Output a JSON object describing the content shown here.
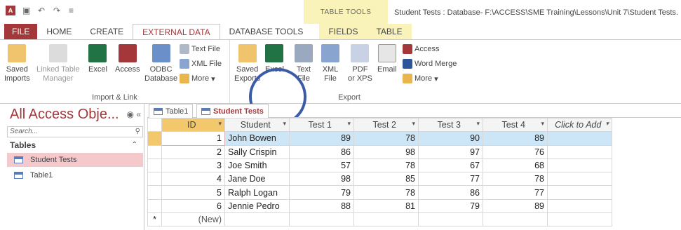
{
  "title_bar": {
    "app_badge": "A",
    "table_tools_label": "TABLE TOOLS",
    "window_title": "Student Tests : Database- F:\\ACCESS\\SME Training\\Lessons\\Unit 7\\Student Tests."
  },
  "ribbon_tabs": {
    "file": "FILE",
    "home": "HOME",
    "create": "CREATE",
    "external_data": "EXTERNAL DATA",
    "database_tools": "DATABASE TOOLS",
    "fields": "FIELDS",
    "table": "TABLE"
  },
  "import_group": {
    "label": "Import & Link",
    "saved_imports": [
      "Saved",
      "Imports"
    ],
    "linked_table_manager": [
      "Linked Table",
      "Manager"
    ],
    "excel": "Excel",
    "access": "Access",
    "odbc": [
      "ODBC",
      "Database"
    ],
    "text_file": "Text File",
    "xml_file": "XML File",
    "more": "More"
  },
  "export_group": {
    "label": "Export",
    "saved_exports": [
      "Saved",
      "Exports"
    ],
    "excel": "Excel",
    "text_file": [
      "Text",
      "File"
    ],
    "xml_file": [
      "XML",
      "File"
    ],
    "pdf_xps": [
      "PDF",
      "or XPS"
    ],
    "email": "Email",
    "access": "Access",
    "word_merge": "Word Merge",
    "more": "More"
  },
  "nav_pane": {
    "title": "All Access Obje...",
    "search_placeholder": "Search...",
    "group_label": "Tables",
    "items": [
      "Student Tests",
      "Table1"
    ]
  },
  "doc_tabs": [
    "Table1",
    "Student Tests"
  ],
  "datasheet": {
    "columns": [
      "ID",
      "Student",
      "Test 1",
      "Test 2",
      "Test 3",
      "Test 4",
      "Click to Add"
    ],
    "rows": [
      {
        "id": "1",
        "student": "John Bowen",
        "t1": "89",
        "t2": "78",
        "t3": "90",
        "t4": "89"
      },
      {
        "id": "2",
        "student": "Sally Crispin",
        "t1": "86",
        "t2": "98",
        "t3": "97",
        "t4": "76"
      },
      {
        "id": "3",
        "student": "Joe Smith",
        "t1": "57",
        "t2": "78",
        "t3": "67",
        "t4": "68"
      },
      {
        "id": "4",
        "student": "Jane Doe",
        "t1": "98",
        "t2": "85",
        "t3": "77",
        "t4": "78"
      },
      {
        "id": "5",
        "student": "Ralph Logan",
        "t1": "79",
        "t2": "78",
        "t3": "86",
        "t4": "77"
      },
      {
        "id": "6",
        "student": "Jennie Pedro",
        "t1": "88",
        "t2": "81",
        "t3": "79",
        "t4": "89"
      }
    ],
    "new_row_marker": "*",
    "new_row_label": "(New)"
  },
  "colors": {
    "access_red": "#a4373a",
    "selection_blue": "#cde6f7",
    "highlight_circle": "#3b5ba8"
  }
}
